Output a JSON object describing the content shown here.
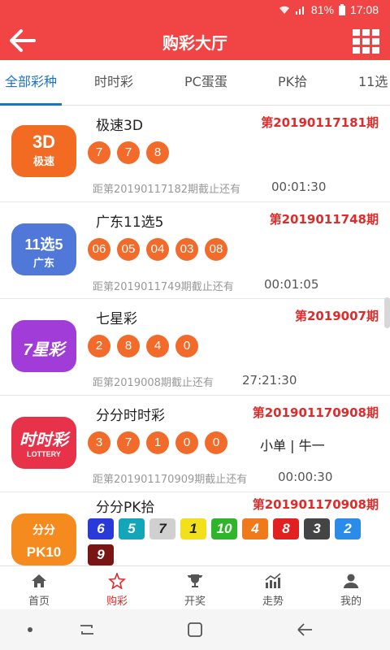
{
  "status_bar": {
    "battery": "81%",
    "time": "17:08"
  },
  "header": {
    "title": "购彩大厅"
  },
  "tabs": [
    {
      "label": "全部彩种"
    },
    {
      "label": "时时彩"
    },
    {
      "label": "PC蛋蛋"
    },
    {
      "label": "PK拾"
    },
    {
      "label": "11选"
    }
  ],
  "lotteries": [
    {
      "name": "极速3D",
      "issue": "第20190117181期",
      "logo": {
        "line1": "3D",
        "line2": "极速",
        "color": "#f36a23"
      },
      "numbers": [
        "7",
        "7",
        "8"
      ],
      "countdown": "距第20190117182期截止还有",
      "time": "00:01:30"
    },
    {
      "name": "广东11选5",
      "issue": "第2019011748期",
      "logo": {
        "line1": "11选5",
        "line2": "广东",
        "color": "#4f78d8"
      },
      "numbers": [
        "06",
        "05",
        "04",
        "03",
        "08"
      ],
      "countdown": "距第2019011749期截止还有",
      "time": "00:01:05"
    },
    {
      "name": "七星彩",
      "issue": "第2019007期",
      "logo": {
        "line1": "7星彩",
        "line2": "",
        "color": "#a23cd8"
      },
      "numbers": [
        "2",
        "8",
        "4",
        "0"
      ],
      "countdown": "距第2019008期截止还有",
      "time": "27:21:30"
    },
    {
      "name": "分分时时彩",
      "issue": "第201901170908期",
      "logo": {
        "line1": "时时彩",
        "line2": "LOTTERY",
        "color": "#e8324a"
      },
      "numbers": [
        "3",
        "7",
        "1",
        "0",
        "0"
      ],
      "extra": "小单 | 牛一",
      "countdown": "距第201901170909期截止还有",
      "time": "00:00:30"
    },
    {
      "name": "分分PK拾",
      "issue": "第201901170908期",
      "logo": {
        "line1": "分分",
        "line2": "PK10",
        "color": "#f58a1f"
      },
      "pk_numbers": [
        {
          "n": "6",
          "color": "#2a3ad8"
        },
        {
          "n": "5",
          "color": "#13a6b8"
        },
        {
          "n": "7",
          "color": "#d0d0d0"
        },
        {
          "n": "1",
          "color": "#f2e01b"
        },
        {
          "n": "10",
          "color": "#2fb52a"
        },
        {
          "n": "4",
          "color": "#f07a1a"
        },
        {
          "n": "8",
          "color": "#e22020"
        },
        {
          "n": "3",
          "color": "#444444"
        },
        {
          "n": "2",
          "color": "#2a8be8"
        },
        {
          "n": "9",
          "color": "#7a1515"
        }
      ]
    }
  ],
  "bottom_nav": [
    {
      "label": "首页",
      "icon": "home-icon"
    },
    {
      "label": "购彩",
      "icon": "star-icon",
      "active": true
    },
    {
      "label": "开奖",
      "icon": "trophy-icon"
    },
    {
      "label": "走势",
      "icon": "trend-icon"
    },
    {
      "label": "我的",
      "icon": "user-icon"
    }
  ]
}
